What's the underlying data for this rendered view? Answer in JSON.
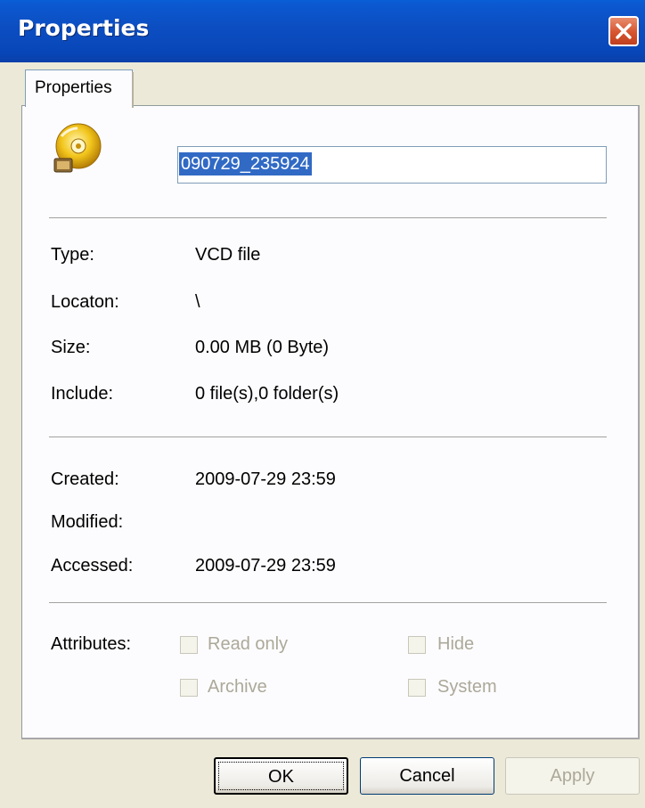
{
  "window": {
    "title": "Properties"
  },
  "tabs": [
    {
      "label": "Properties"
    }
  ],
  "file": {
    "name": "090729_235924",
    "icon": "vcd-disc-icon"
  },
  "info": {
    "type": {
      "label": "Type:",
      "value": "VCD file"
    },
    "location": {
      "label": "Locaton:",
      "value": "\\"
    },
    "size": {
      "label": "Size:",
      "value": "0.00 MB  (0 Byte)"
    },
    "include": {
      "label": "Include:",
      "value": "0 file(s),0 folder(s)"
    }
  },
  "dates": {
    "created": {
      "label": "Created:",
      "value": "2009-07-29 23:59"
    },
    "modified": {
      "label": "Modified:",
      "value": ""
    },
    "accessed": {
      "label": "Accessed:",
      "value": "2009-07-29 23:59"
    }
  },
  "attributes": {
    "label": "Attributes:",
    "items": [
      {
        "label": "Read only",
        "checked": false,
        "enabled": false
      },
      {
        "label": "Hide",
        "checked": false,
        "enabled": false
      },
      {
        "label": "Archive",
        "checked": false,
        "enabled": false
      },
      {
        "label": "System",
        "checked": false,
        "enabled": false
      }
    ]
  },
  "buttons": {
    "ok": "OK",
    "cancel": "Cancel",
    "apply": "Apply"
  },
  "colors": {
    "titlebar": "#0b4fc4",
    "dialog_bg": "#ece9d8",
    "selection": "#316ac5"
  }
}
